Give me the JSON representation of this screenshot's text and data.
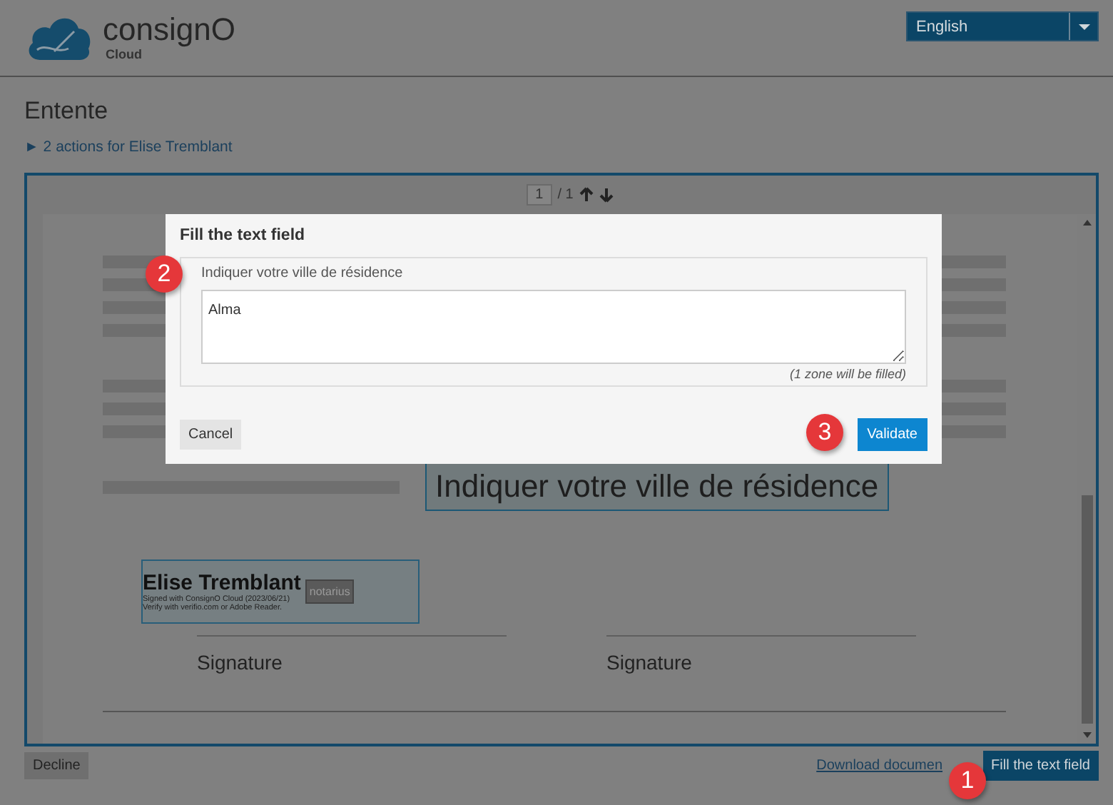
{
  "header": {
    "logo_name": "consignO",
    "logo_sub": "Cloud",
    "language": "English"
  },
  "title": "Entente",
  "actions_link": "► 2 actions for Elise Tremblant",
  "viewer": {
    "page": "1",
    "page_count": "/ 1",
    "field_text": "Indiquer votre ville de résidence",
    "stamp": {
      "name": "Elise Tremblant",
      "line1": "Signed with ConsignO Cloud (2023/06/21)",
      "line2": "Verify with verifio.com or Adobe Reader.",
      "seal": "notarius"
    },
    "signatures": [
      "Signature",
      "Signature"
    ]
  },
  "dialog": {
    "title": "Fill the text field",
    "label": "Indiquer votre ville de résidence",
    "value": "Alma",
    "note": "(1 zone will be filled)",
    "cancel": "Cancel",
    "validate": "Validate"
  },
  "footer": {
    "decline": "Decline",
    "download": "Download documen",
    "primary": "Fill the text field"
  },
  "callouts": [
    "1",
    "2",
    "3"
  ]
}
